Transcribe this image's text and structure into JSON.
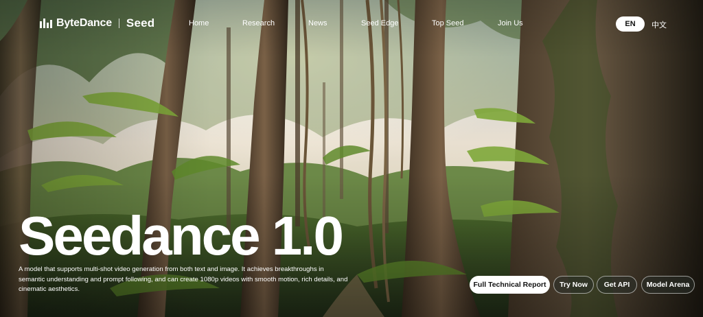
{
  "brand": {
    "company": "ByteDance",
    "product": "Seed"
  },
  "nav": {
    "items": [
      {
        "label": "Home"
      },
      {
        "label": "Research"
      },
      {
        "label": "News"
      },
      {
        "label": "Seed Edge"
      },
      {
        "label": "Top Seed"
      },
      {
        "label": "Join Us"
      }
    ]
  },
  "language": {
    "active": "EN",
    "alternate": "中文"
  },
  "hero": {
    "title": "Seedance 1.0",
    "description": "A model that supports multi-shot video generation from both text and image. It achieves breakthroughs in semantic understanding and prompt following, and can create 1080p videos with smooth motion, rich details, and cinematic aesthetics.",
    "buttons": [
      {
        "label": "Full Technical Report"
      },
      {
        "label": "Try Now"
      },
      {
        "label": "Get API"
      },
      {
        "label": "Model Arena"
      }
    ]
  },
  "colors": {
    "text": "#ffffff",
    "primary_button_bg": "#ffffff",
    "primary_button_text": "#111111"
  },
  "background_image": "rainforest-scene"
}
